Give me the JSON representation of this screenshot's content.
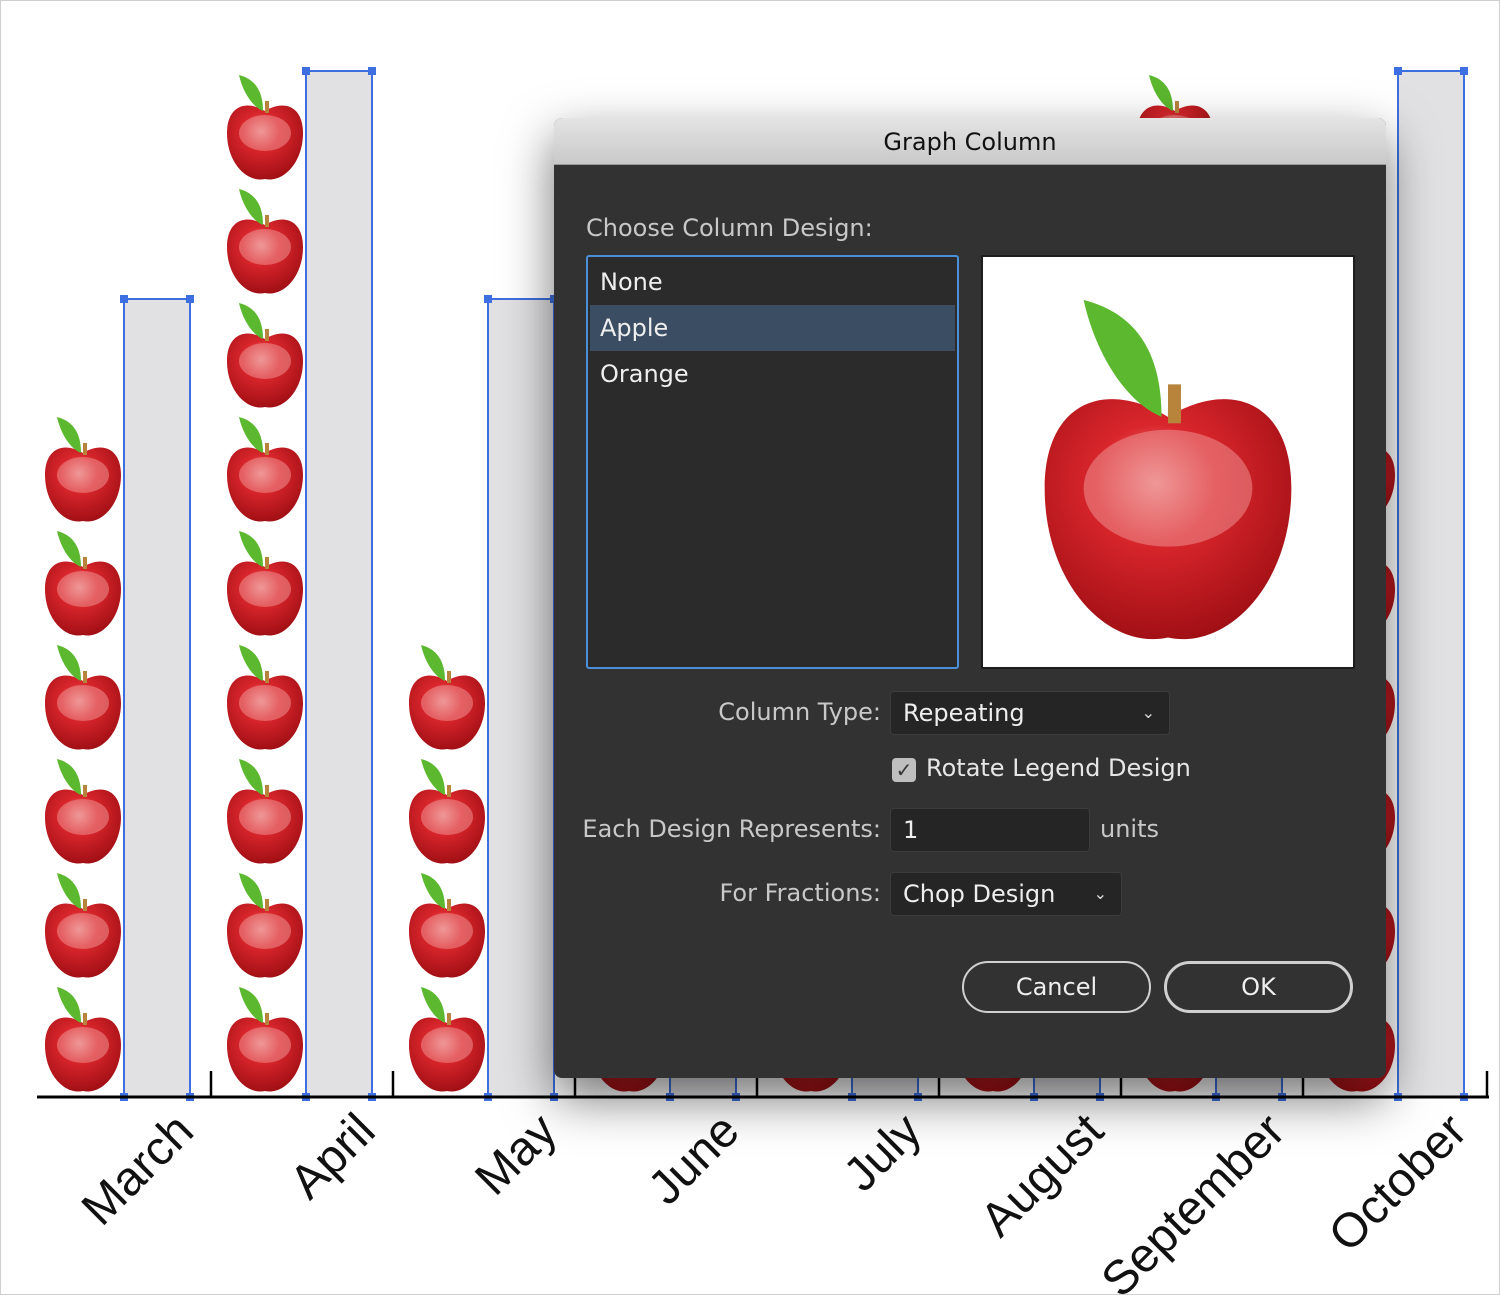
{
  "chart_data": {
    "type": "bar",
    "categories": [
      "March",
      "April",
      "May",
      "June",
      "July",
      "August",
      "September",
      "October"
    ],
    "series": [
      {
        "design": "Apple",
        "values": [
          6,
          9,
          4,
          null,
          null,
          null,
          9,
          6
        ]
      },
      {
        "design": "none",
        "values": [
          7,
          9,
          7,
          null,
          null,
          null,
          null,
          9
        ]
      }
    ],
    "grid": false,
    "colors": {
      "apple": "#c8161d",
      "leaf": "#5cb82e",
      "bar": "#e1e1e3",
      "selection": "#3d6fe0"
    }
  },
  "dialog": {
    "title": "Graph Column",
    "choose_label": "Choose Column Design:",
    "designs": [
      "None",
      "Apple",
      "Orange"
    ],
    "selected_design": "Apple",
    "column_type_label": "Column Type:",
    "column_type_value": "Repeating",
    "rotate_legend_label": "Rotate Legend Design",
    "rotate_legend_checked": true,
    "each_design_label": "Each Design Represents:",
    "each_design_value": "1",
    "units_label": "units",
    "fractions_label": "For Fractions:",
    "fractions_value": "Chop Design",
    "cancel_label": "Cancel",
    "ok_label": "OK",
    "accent": "#4a8fd8"
  }
}
